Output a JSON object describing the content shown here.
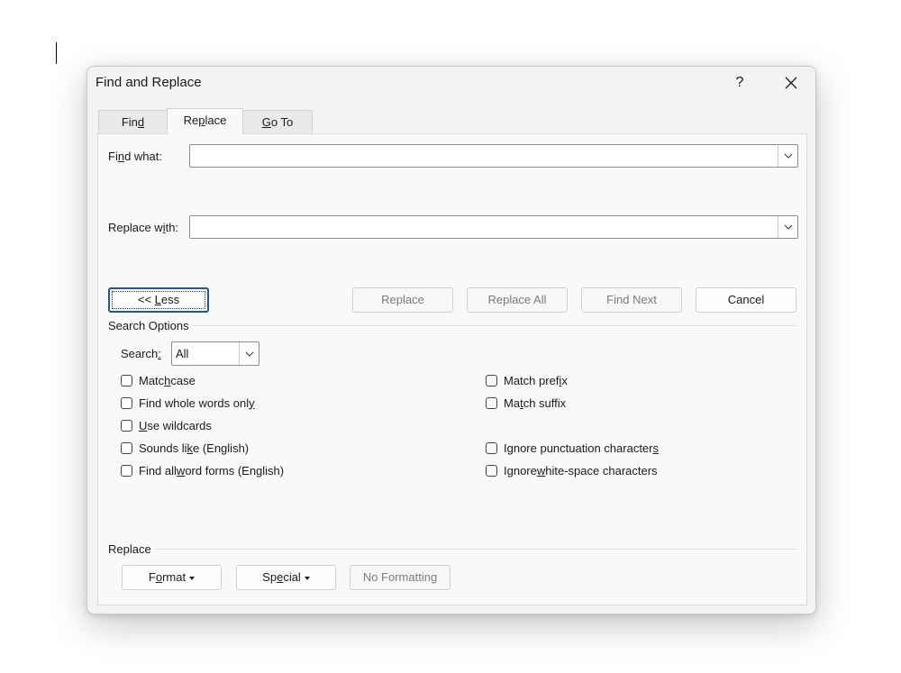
{
  "window": {
    "title": "Find and Replace",
    "help_label": "?"
  },
  "tabs": [
    {
      "label_pre": "Fin",
      "label_u": "d",
      "label_post": ""
    },
    {
      "label_pre": "Re",
      "label_u": "p",
      "label_post": "lace"
    },
    {
      "label_pre": "",
      "label_u": "G",
      "label_post": "o To"
    }
  ],
  "find": {
    "label_pre": "Fi",
    "label_u": "n",
    "label_post": "d what:",
    "value": ""
  },
  "replace": {
    "label_pre": "Replace w",
    "label_u": "i",
    "label_post": "th:",
    "value": ""
  },
  "buttons": {
    "less_pre": "<< ",
    "less_u": "L",
    "less_post": "ess",
    "replace": "Replace",
    "replace_all": "Replace All",
    "find_next": "Find Next",
    "cancel": "Cancel"
  },
  "search_options": {
    "heading": "Search Options",
    "search_label_pre": "Search",
    "search_label_u": ":",
    "search_label_post": "",
    "search_value": "All"
  },
  "options_left": [
    {
      "pre": "Matc",
      "u": "h",
      "post": " case"
    },
    {
      "pre": "Find whole words onl",
      "u": "y",
      "post": ""
    },
    {
      "pre": "",
      "u": "U",
      "post": "se wildcards"
    },
    {
      "pre": "Sounds li",
      "u": "k",
      "post": "e (English)"
    },
    {
      "pre": "Find all ",
      "u": "w",
      "post": "ord forms (English)"
    }
  ],
  "options_right": [
    {
      "pre": "Match pref",
      "u": "i",
      "post": "x"
    },
    {
      "pre": "Ma",
      "u": "t",
      "post": "ch suffix"
    },
    {
      "pre": "Ignore punctuation character",
      "u": "s",
      "post": ""
    },
    {
      "pre": "Ignore ",
      "u": "w",
      "post": "hite-space characters"
    }
  ],
  "replace_section": {
    "heading": "Replace",
    "format_pre": "F",
    "format_u": "o",
    "format_post": "rmat",
    "special_pre": "Sp",
    "special_u": "e",
    "special_post": "cial",
    "no_formatting": "No Formatting"
  }
}
